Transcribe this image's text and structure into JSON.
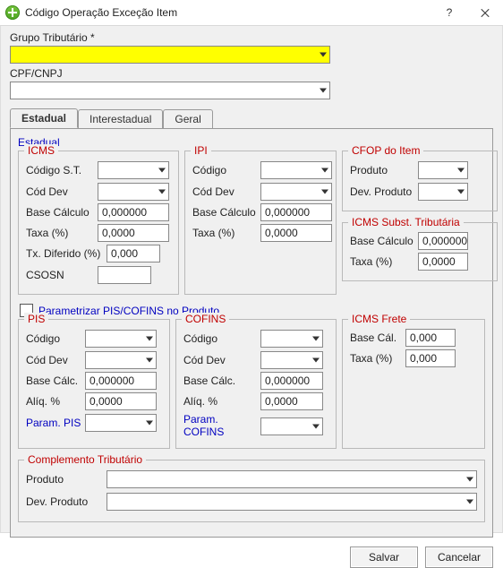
{
  "window": {
    "title": "Código Operação Exceção Item",
    "help": "?",
    "close": "X"
  },
  "labels": {
    "grupo_tributario": "Grupo Tributário *",
    "cpf_cnpj": "CPF/CNPJ"
  },
  "tabs": {
    "estadual": "Estadual",
    "interestadual": "Interestadual",
    "geral": "Geral"
  },
  "estadual_legend": "Estadual",
  "icms": {
    "legend": "ICMS",
    "codigo_st_lbl": "Código S.T.",
    "cod_dev_lbl": "Cód Dev",
    "base_calc_lbl": "Base Cálculo",
    "taxa_lbl": "Taxa (%)",
    "tx_diferido_lbl": "Tx. Diferido (%)",
    "csosn_lbl": "CSOSN",
    "codigo_st": "",
    "cod_dev": "",
    "base_calc": "0,000000",
    "taxa": "0,0000",
    "tx_diferido": "0,000",
    "csosn": ""
  },
  "ipi": {
    "legend": "IPI",
    "codigo_lbl": "Código",
    "cod_dev_lbl": "Cód Dev",
    "base_calc_lbl": "Base Cálculo",
    "taxa_lbl": "Taxa (%)",
    "codigo": "",
    "cod_dev": "",
    "base_calc": "0,000000",
    "taxa": "0,0000"
  },
  "cfop": {
    "legend": "CFOP do Item",
    "produto_lbl": "Produto",
    "dev_produto_lbl": "Dev. Produto",
    "produto": "",
    "dev_produto": ""
  },
  "icms_st": {
    "legend": "ICMS Subst. Tributária",
    "base_calc_lbl": "Base Cálculo",
    "taxa_lbl": "Taxa (%)",
    "base_calc": "0,000000",
    "taxa": "0,0000"
  },
  "param_piscofins_lbl": "Parametrizar PIS/COFINS no Produto",
  "pis": {
    "legend": "PIS",
    "codigo_lbl": "Código",
    "cod_dev_lbl": "Cód Dev",
    "base_calc_lbl": "Base Cálc.",
    "aliq_lbl": "Alíq. %",
    "param_lbl": "Param. PIS",
    "codigo": "",
    "cod_dev": "",
    "base_calc": "0,000000",
    "aliq": "0,0000",
    "param": ""
  },
  "cofins": {
    "legend": "COFINS",
    "codigo_lbl": "Código",
    "cod_dev_lbl": "Cód Dev",
    "base_calc_lbl": "Base Cálc.",
    "aliq_lbl": "Alíq. %",
    "param_lbl": "Param. COFINS",
    "codigo": "",
    "cod_dev": "",
    "base_calc": "0,000000",
    "aliq": "0,0000",
    "param": ""
  },
  "frete": {
    "legend": "ICMS Frete",
    "base_cal_lbl": "Base Cál.",
    "taxa_lbl": "Taxa (%)",
    "base_cal": "0,000",
    "taxa": "0,000"
  },
  "complemento": {
    "legend": "Complemento Tributário",
    "produto_lbl": "Produto",
    "dev_produto_lbl": "Dev. Produto",
    "produto": "",
    "dev_produto": ""
  },
  "buttons": {
    "salvar": "Salvar",
    "cancelar": "Cancelar"
  }
}
